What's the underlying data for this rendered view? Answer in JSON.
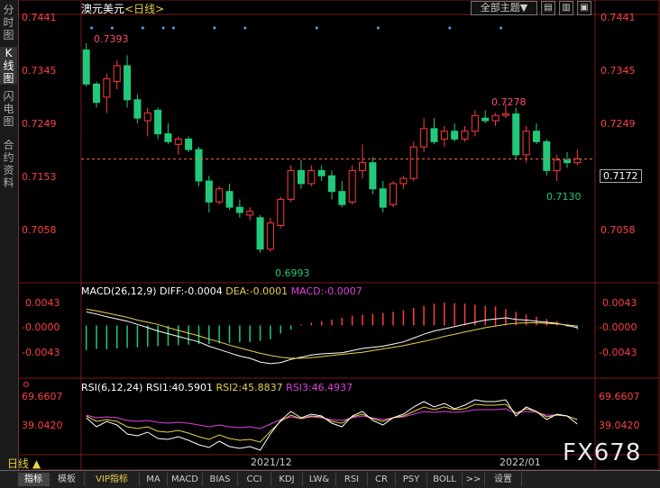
{
  "sidebar": {
    "tabs": [
      {
        "label": "分时图",
        "active": false
      },
      {
        "label": "K线图",
        "active": true
      },
      {
        "label": "闪电图",
        "active": false
      },
      {
        "label": "合约资料",
        "active": false
      }
    ]
  },
  "header": {
    "instrument": "澳元美元",
    "period": "<日线>",
    "theme_button": "全部主题▼",
    "win_buttons": [
      "▤",
      "▥",
      "▣"
    ]
  },
  "price_axis": {
    "labels": [
      "0.7441",
      "0.7345",
      "0.7249",
      "0.7153",
      "0.7058"
    ],
    "current_price": "0.7172"
  },
  "price_annotations": {
    "high_left": "0.7393",
    "high_right": "0.7278",
    "low_left": "0.6993",
    "low_right": "0.7130"
  },
  "macd": {
    "title": "MACD(26,12,9)",
    "diff": "DIFF:-0.0004",
    "dea": "DEA:-0.0001",
    "macd": "MACD:-0.0007",
    "axis_labels": [
      "0.0043",
      "-0.0000",
      "-0.0043"
    ]
  },
  "rsi": {
    "title": "RSI(6,12,24)",
    "rsi1": "RSI1:40.5901",
    "rsi2": "RSI2:45.8837",
    "rsi3": "RSI3:46.4937",
    "axis_labels": [
      "69.6607",
      "39.0420"
    ]
  },
  "dates": [
    "2021/12",
    "2022/01"
  ],
  "period_label": "日线 ▲",
  "watermark": "FX678",
  "bottom_tabs": [
    "指标",
    "模板",
    "VIP指标",
    "MA",
    "MACD",
    "BIAS",
    "CCI",
    "KDJ",
    "LW&",
    "RSI",
    "CR",
    "PSY",
    "BOLL",
    ">>",
    "设置"
  ],
  "colors": {
    "up": "#ff3c3c",
    "down": "#22c97b",
    "diff": "#ffffff",
    "dea": "#e6d24a",
    "macd": "#e040e0",
    "axis": "#ff4040"
  },
  "chart_data": {
    "type": "candlestick",
    "y_range": [
      0.696,
      0.7441
    ],
    "candles": [
      [
        0.738,
        0.7393,
        0.731,
        0.7315
      ],
      [
        0.7315,
        0.732,
        0.727,
        0.728
      ],
      [
        0.729,
        0.7335,
        0.726,
        0.7325
      ],
      [
        0.732,
        0.736,
        0.7305,
        0.735
      ],
      [
        0.735,
        0.737,
        0.727,
        0.7285
      ],
      [
        0.7285,
        0.7295,
        0.724,
        0.725
      ],
      [
        0.7245,
        0.727,
        0.7215,
        0.726
      ],
      [
        0.7265,
        0.727,
        0.721,
        0.722
      ],
      [
        0.722,
        0.724,
        0.72,
        0.7205
      ],
      [
        0.72,
        0.7215,
        0.718,
        0.721
      ],
      [
        0.721,
        0.7215,
        0.7185,
        0.719
      ],
      [
        0.719,
        0.7195,
        0.712,
        0.713
      ],
      [
        0.713,
        0.714,
        0.707,
        0.709
      ],
      [
        0.709,
        0.712,
        0.7085,
        0.7115
      ],
      [
        0.711,
        0.7125,
        0.7075,
        0.708
      ],
      [
        0.708,
        0.7095,
        0.706,
        0.707
      ],
      [
        0.7065,
        0.708,
        0.7055,
        0.7072
      ],
      [
        0.706,
        0.7065,
        0.6993,
        0.7
      ],
      [
        0.7,
        0.706,
        0.6995,
        0.705
      ],
      [
        0.7045,
        0.71,
        0.704,
        0.7095
      ],
      [
        0.7095,
        0.716,
        0.709,
        0.715
      ],
      [
        0.715,
        0.717,
        0.7115,
        0.7125
      ],
      [
        0.7125,
        0.716,
        0.712,
        0.715
      ],
      [
        0.715,
        0.716,
        0.713,
        0.714
      ],
      [
        0.714,
        0.715,
        0.7095,
        0.711
      ],
      [
        0.711,
        0.713,
        0.708,
        0.7085
      ],
      [
        0.709,
        0.716,
        0.7085,
        0.715
      ],
      [
        0.715,
        0.72,
        0.7135,
        0.7165
      ],
      [
        0.7165,
        0.7175,
        0.7105,
        0.7115
      ],
      [
        0.7115,
        0.713,
        0.707,
        0.708
      ],
      [
        0.7085,
        0.713,
        0.708,
        0.7125
      ],
      [
        0.7125,
        0.714,
        0.7115,
        0.7135
      ],
      [
        0.7135,
        0.7205,
        0.713,
        0.7195
      ],
      [
        0.7195,
        0.725,
        0.7185,
        0.723
      ],
      [
        0.723,
        0.725,
        0.72,
        0.7205
      ],
      [
        0.721,
        0.7235,
        0.7195,
        0.7225
      ],
      [
        0.7225,
        0.724,
        0.7205,
        0.721
      ],
      [
        0.721,
        0.7235,
        0.7205,
        0.7225
      ],
      [
        0.7225,
        0.7265,
        0.7215,
        0.7255
      ],
      [
        0.725,
        0.7265,
        0.724,
        0.7245
      ],
      [
        0.7245,
        0.726,
        0.7235,
        0.7255
      ],
      [
        0.7255,
        0.7278,
        0.725,
        0.7258
      ],
      [
        0.7258,
        0.727,
        0.717,
        0.718
      ],
      [
        0.718,
        0.7235,
        0.7165,
        0.7225
      ],
      [
        0.7225,
        0.724,
        0.72,
        0.7205
      ],
      [
        0.7205,
        0.721,
        0.714,
        0.715
      ],
      [
        0.715,
        0.718,
        0.713,
        0.717
      ],
      [
        0.717,
        0.7185,
        0.7155,
        0.7165
      ],
      [
        0.7165,
        0.719,
        0.716,
        0.7172
      ]
    ],
    "macd_range": [
      -0.008,
      0.0052
    ],
    "macd_hist": [
      -0.0045,
      -0.0043,
      -0.0044,
      -0.0042,
      -0.0041,
      -0.004,
      -0.0039,
      -0.0038,
      -0.0037,
      -0.0036,
      -0.0035,
      -0.0034,
      -0.0034,
      -0.0033,
      -0.0032,
      -0.0031,
      -0.003,
      -0.0028,
      -0.0025,
      -0.0015,
      -0.0008,
      0.0002,
      0.0005,
      0.0008,
      0.0011,
      0.0014,
      0.0018,
      0.002,
      0.0021,
      0.0023,
      0.0025,
      0.0028,
      0.0032,
      0.0036,
      0.004,
      0.0042,
      0.0041,
      0.004,
      0.0038,
      0.0036,
      0.0035,
      0.003,
      0.0025,
      0.002,
      0.0016,
      0.0012,
      0.0008,
      -0.0002,
      -0.0007
    ],
    "macd_diff": [
      0.0025,
      0.0021,
      0.0016,
      0.0012,
      0.0008,
      0.0002,
      -0.0004,
      -0.001,
      -0.0015,
      -0.002,
      -0.0025,
      -0.003,
      -0.0038,
      -0.0044,
      -0.005,
      -0.0056,
      -0.006,
      -0.0067,
      -0.007,
      -0.0068,
      -0.0062,
      -0.0058,
      -0.0054,
      -0.0052,
      -0.0051,
      -0.005,
      -0.0046,
      -0.0042,
      -0.004,
      -0.0038,
      -0.0034,
      -0.003,
      -0.0023,
      -0.0016,
      -0.001,
      -0.0006,
      -0.0002,
      0.0002,
      0.0006,
      0.001,
      0.0012,
      0.0014,
      0.0011,
      0.001,
      0.0008,
      0.0006,
      0.0004,
      0.0,
      -0.0004
    ],
    "macd_dea": [
      0.003,
      0.0027,
      0.0023,
      0.0019,
      0.0015,
      0.001,
      0.0006,
      0.0002,
      -0.0004,
      -0.0009,
      -0.0014,
      -0.0019,
      -0.0025,
      -0.003,
      -0.0036,
      -0.0041,
      -0.0046,
      -0.0051,
      -0.0055,
      -0.0058,
      -0.006,
      -0.006,
      -0.0059,
      -0.0057,
      -0.0055,
      -0.0053,
      -0.0051,
      -0.0049,
      -0.0046,
      -0.0043,
      -0.004,
      -0.0037,
      -0.0033,
      -0.0029,
      -0.0025,
      -0.002,
      -0.0016,
      -0.0012,
      -0.0008,
      -0.0004,
      -0.0001,
      0.0002,
      0.0004,
      0.0005,
      0.0005,
      0.0004,
      0.0003,
      0.0001,
      -0.0001
    ],
    "rsi_range": [
      10,
      80
    ],
    "rsi1": [
      48,
      38,
      44,
      40,
      30,
      28,
      32,
      25,
      24,
      27,
      23,
      18,
      15,
      22,
      16,
      14,
      16,
      12,
      30,
      45,
      55,
      48,
      52,
      50,
      42,
      38,
      50,
      55,
      45,
      40,
      48,
      52,
      60,
      66,
      60,
      64,
      58,
      62,
      68,
      66,
      66,
      68,
      50,
      60,
      55,
      46,
      52,
      50,
      41
    ],
    "rsi2": [
      50,
      44,
      46,
      44,
      38,
      36,
      38,
      33,
      32,
      34,
      31,
      27,
      24,
      29,
      25,
      23,
      24,
      21,
      33,
      44,
      51,
      47,
      50,
      49,
      44,
      42,
      49,
      52,
      47,
      44,
      48,
      50,
      55,
      60,
      57,
      60,
      57,
      58,
      63,
      62,
      62,
      63,
      53,
      58,
      55,
      49,
      51,
      50,
      46
    ],
    "rsi3": [
      51,
      48,
      49,
      48,
      45,
      44,
      45,
      43,
      42,
      43,
      42,
      40,
      38,
      40,
      38,
      37,
      38,
      36,
      41,
      46,
      49,
      47,
      49,
      48,
      46,
      45,
      48,
      50,
      48,
      46,
      48,
      49,
      52,
      55,
      54,
      55,
      54,
      55,
      57,
      57,
      57,
      58,
      53,
      55,
      54,
      51,
      51,
      50,
      46
    ]
  }
}
